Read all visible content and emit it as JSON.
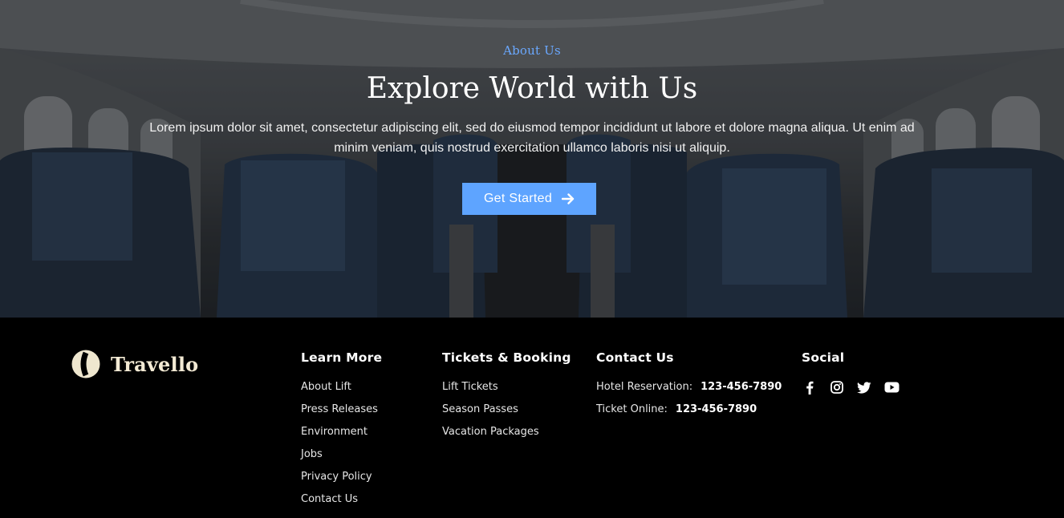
{
  "hero": {
    "eyebrow": "About Us",
    "title": "Explore World with Us",
    "text": "Lorem ipsum dolor sit amet, consectetur adipiscing elit, sed do eiusmod tempor incididunt ut labore et dolore magna aliqua. Ut enim ad minim veniam, quis nostrud exercitation ullamco laboris nisi ut aliquip.",
    "cta_label": "Get Started",
    "cta_icon": "arrow-right-icon",
    "accent": "#5ea4ff"
  },
  "footer": {
    "brand": {
      "name": "Travello",
      "logo_icon": "travello-logo-icon",
      "logo_color": "#efe7cf"
    },
    "learn_more": {
      "title": "Learn More",
      "links": [
        "About Lift",
        "Press Releases",
        "Environment",
        "Jobs",
        "Privacy Policy",
        "Contact Us"
      ]
    },
    "tickets": {
      "title": "Tickets & Booking",
      "links": [
        "Lift Tickets",
        "Season Passes",
        "Vacation Packages"
      ]
    },
    "contact": {
      "title": "Contact Us",
      "rows": [
        {
          "label": "Hotel Reservation:",
          "value": "123-456-7890"
        },
        {
          "label": "Ticket Online:",
          "value": "123-456-7890"
        }
      ]
    },
    "social": {
      "title": "Social",
      "icons": [
        "facebook-icon",
        "instagram-icon",
        "twitter-icon",
        "youtube-icon"
      ]
    }
  }
}
